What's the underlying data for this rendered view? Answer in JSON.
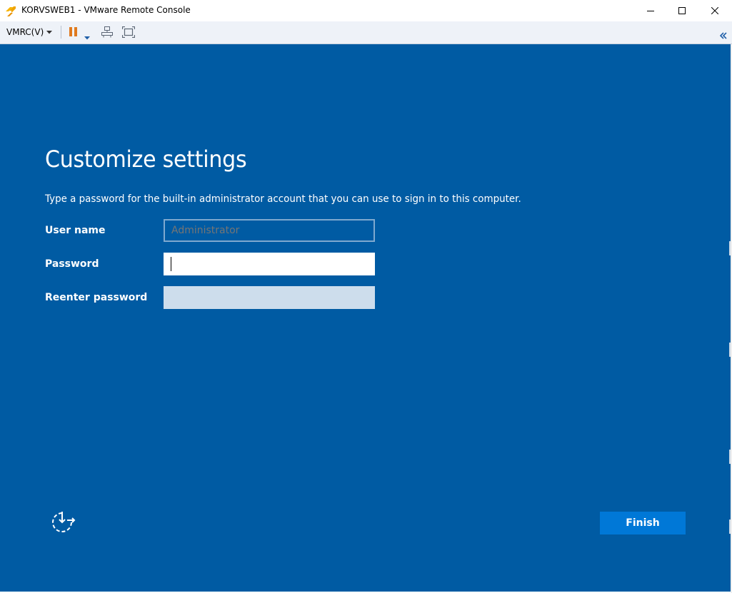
{
  "window": {
    "title": "KORVSWEB1 - VMware Remote Console"
  },
  "toolbar": {
    "menu_label": "VMRC(V)",
    "icons": [
      "pause-icon",
      "send-ctrl-alt-del-icon",
      "fullscreen-icon",
      "collapse-icon"
    ]
  },
  "oobe": {
    "title": "Customize settings",
    "description": "Type a password for the built-in administrator account that you can use to sign in to this computer.",
    "fields": [
      {
        "label": "User name",
        "placeholder": "Administrator",
        "value": ""
      },
      {
        "label": "Password",
        "value": ""
      },
      {
        "label": "Reenter password",
        "value": ""
      }
    ],
    "finish_label": "Finish"
  },
  "colors": {
    "background": "#005ba3",
    "button": "#0078d7",
    "pause_icon": "#e07a1f"
  }
}
